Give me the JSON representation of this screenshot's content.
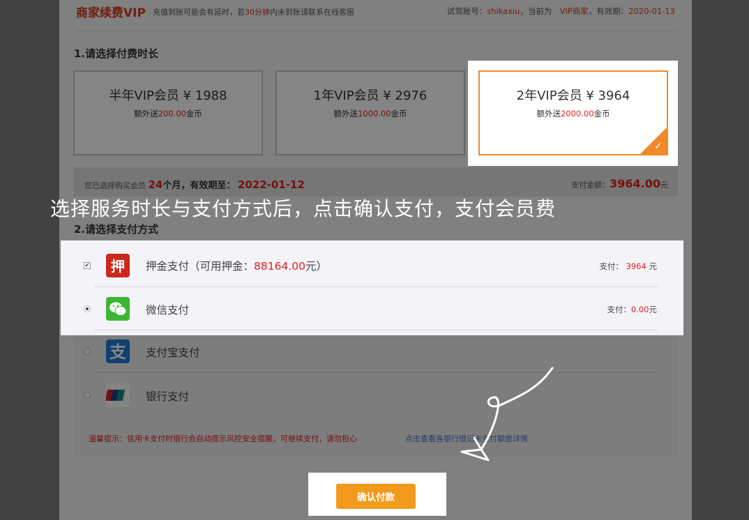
{
  "header": {
    "title": "商家续费VIP",
    "notice_pre": "充值到账可能会有延时，若",
    "notice_red": "30分钟",
    "notice_post": "内未到账请联系在线客服",
    "account_label": "试驾账号：",
    "account": "shikaxiu",
    "current_label": "，当前为",
    "level": "VIP商家",
    "expiry_label": "，有效期：",
    "expiry": "2020-01-13"
  },
  "section1": "1.请选择付费时长",
  "plans": [
    {
      "name": "半年VIP会员 ¥ 1988",
      "bonus_pre": "额外送",
      "bonus": "200.00",
      "bonus_post": "金币"
    },
    {
      "name": "1年VIP会员 ¥ 2976",
      "bonus_pre": "额外送",
      "bonus": "1000.00",
      "bonus_post": "金币"
    },
    {
      "name": "2年VIP会员 ¥ 3964",
      "bonus_pre": "额外送",
      "bonus": "2000.00",
      "bonus_post": "金币"
    }
  ],
  "summary": {
    "label": "您已选择购买会员",
    "months": "24",
    "months_suffix": "个月，有效期至：",
    "date": "2022-01-12",
    "total_label": "支付金额：",
    "total": "3964.00",
    "total_unit": "元"
  },
  "caption": "选择服务时长与支付方式后，点击确认支付，支付会员费",
  "section2": "2.请选择支付方式",
  "payments": [
    {
      "icon_text": "押",
      "label": "押金支付（可用押金：",
      "highlight": "88164.00",
      "label_post": "元）",
      "amount_label": "支付：",
      "amount": "3964",
      "amount_unit": " 元"
    },
    {
      "label": "微信支付",
      "amount_label": "支付：",
      "amount": "0.00",
      "amount_unit": "元"
    },
    {
      "label": "支付宝支付"
    },
    {
      "label": "银行支付"
    }
  ],
  "tips": {
    "left": "温馨提示：信用卡支付时银行会自动提示风控安全提醒，可继续支付，请勿担心",
    "right": "点击查看各银行借记卡支付额度详情"
  },
  "confirm_button": "确认付款",
  "colors": {
    "accent": "#f08a28",
    "red": "#e02020",
    "button": "#f19a1c"
  }
}
